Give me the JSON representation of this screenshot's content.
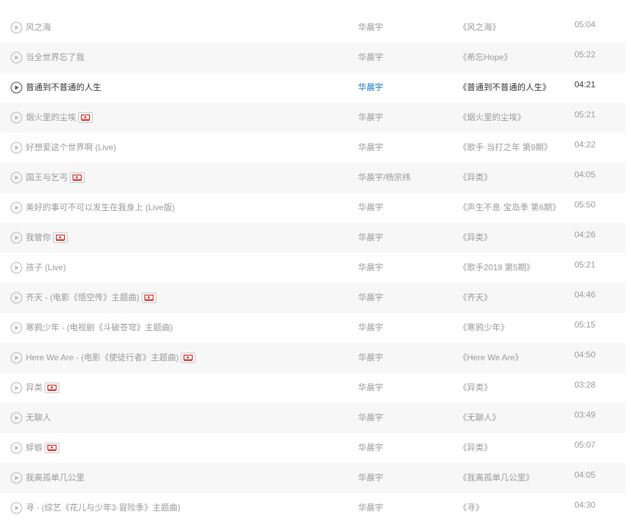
{
  "colors": {
    "text_muted": "#999999",
    "text_active": "#333333",
    "artist_active": "#0c73c2",
    "row_alt_bg": "#f7f7f7",
    "mv_icon_red": "#c20c0c"
  },
  "songs": [
    {
      "title": "风之海",
      "artist": "华晨宇",
      "album": "《风之海》",
      "duration": "05:04",
      "mv": false,
      "active": false
    },
    {
      "title": "当全世界忘了我",
      "artist": "华晨宇",
      "album": "《希忘Hope》",
      "duration": "05:22",
      "mv": false,
      "active": false
    },
    {
      "title": "普通到不普通的人生",
      "artist": "华晨宇",
      "album": "《普通到不普通的人生》",
      "duration": "04:21",
      "mv": false,
      "active": true
    },
    {
      "title": "烟火里的尘埃",
      "artist": "华晨宇",
      "album": "《烟火里的尘埃》",
      "duration": "05:21",
      "mv": true,
      "active": false
    },
    {
      "title": "好想爱这个世界啊 (Live)",
      "artist": "华晨宇",
      "album": "《歌手·当打之年 第9期》",
      "duration": "04:22",
      "mv": false,
      "active": false
    },
    {
      "title": "国王与乞丐",
      "artist": "华晨宇/杨宗纬",
      "album": "《异类》",
      "duration": "04:05",
      "mv": true,
      "active": false
    },
    {
      "title": "美好的事可不可以发生在我身上 (Live版)",
      "artist": "华晨宇",
      "album": "《声生不息·宝岛季 第6期》",
      "duration": "05:50",
      "mv": false,
      "active": false
    },
    {
      "title": "我管你",
      "artist": "华晨宇",
      "album": "《异类》",
      "duration": "04:26",
      "mv": true,
      "active": false
    },
    {
      "title": "孩子 (Live)",
      "artist": "华晨宇",
      "album": "《歌手2018 第5期》",
      "duration": "05:21",
      "mv": false,
      "active": false
    },
    {
      "title": "齐天 - (电影《悟空传》主题曲)",
      "artist": "华晨宇",
      "album": "《齐天》",
      "duration": "04:46",
      "mv": true,
      "active": false
    },
    {
      "title": "寒鸦少年 - (电视剧《斗破苍穹》主题曲)",
      "artist": "华晨宇",
      "album": "《寒鸦少年》",
      "duration": "05:15",
      "mv": false,
      "active": false
    },
    {
      "title": "Here We Are - (电影《使徒行者》主题曲)",
      "artist": "华晨宇",
      "album": "《Here We Are》",
      "duration": "04:50",
      "mv": true,
      "active": false
    },
    {
      "title": "异类",
      "artist": "华晨宇",
      "album": "《异类》",
      "duration": "03:28",
      "mv": true,
      "active": false
    },
    {
      "title": "无聊人",
      "artist": "华晨宇",
      "album": "《无聊人》",
      "duration": "03:49",
      "mv": false,
      "active": false
    },
    {
      "title": "蜉蝣",
      "artist": "华晨宇",
      "album": "《异类》",
      "duration": "05:07",
      "mv": true,
      "active": false
    },
    {
      "title": "我离孤单几公里",
      "artist": "华晨宇",
      "album": "《我离孤单几公里》",
      "duration": "04:05",
      "mv": false,
      "active": false
    },
    {
      "title": "寻 - (综艺《花儿与少年3·冒险季》主题曲)",
      "artist": "华晨宇",
      "album": "《寻》",
      "duration": "04:30",
      "mv": false,
      "active": false
    }
  ]
}
